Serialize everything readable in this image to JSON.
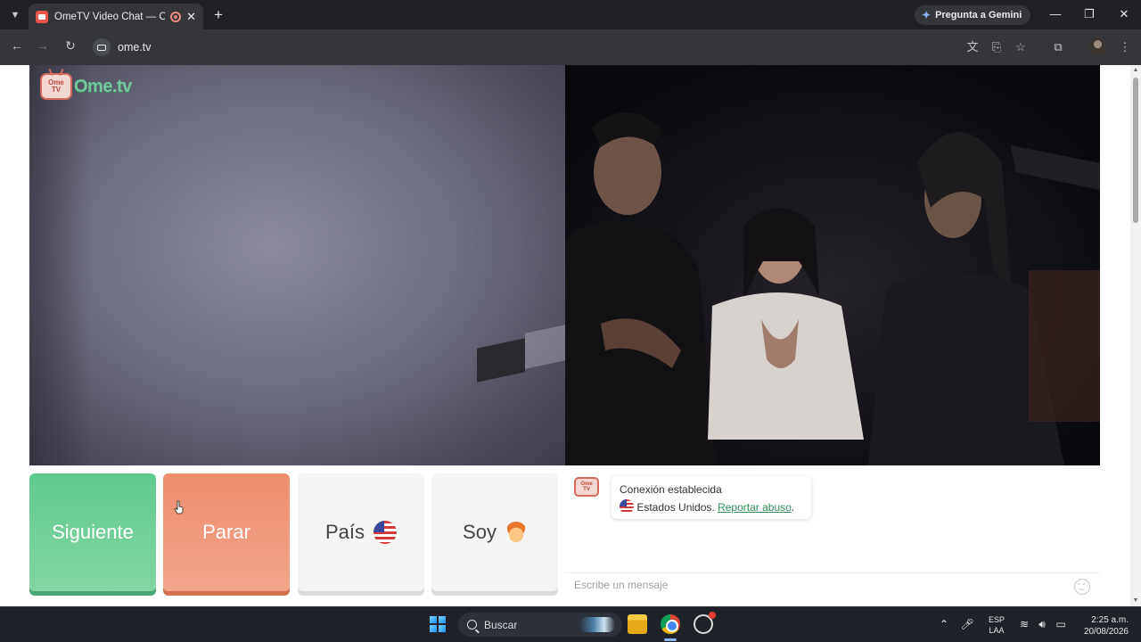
{
  "browser": {
    "tab_title": "OmeTV Video Chat — Ome",
    "url": "ome.tv",
    "gemini_label": "Pregunta a Gemini"
  },
  "page": {
    "logo_text": "Ome.tv",
    "logo_badge_top": "Ome",
    "logo_badge_bottom": "TV",
    "buttons": {
      "next": "Siguiente",
      "stop": "Parar",
      "country": "País",
      "gender": "Soy"
    },
    "chat": {
      "status_title": "Conexión establecida",
      "country_text": "Estados Unidos.",
      "report_link": "Reportar abuso",
      "report_suffix": ".",
      "input_placeholder": "Escribe un mensaje"
    }
  },
  "taskbar": {
    "search_label": "Buscar",
    "lang_top": "ESP",
    "lang_bottom": "LAA",
    "time": "2:25 a.m.",
    "date": "20/08/2026"
  },
  "icons": {
    "tab_search": "chevron-down-icon",
    "close": "close-icon",
    "new_tab": "plus-icon",
    "back": "back-arrow-icon",
    "forward": "forward-arrow-icon",
    "reload": "reload-icon",
    "translate": "translate-icon",
    "cast": "cast-icon",
    "bookmark": "star-icon",
    "extensions": "puzzle-icon",
    "menu": "kebab-menu-icon",
    "emoji": "smiley-icon"
  },
  "colors": {
    "next_button": "#5fca8e",
    "stop_button": "#ee8e6c",
    "link": "#2e8b57",
    "logo_green": "#74c69d"
  }
}
